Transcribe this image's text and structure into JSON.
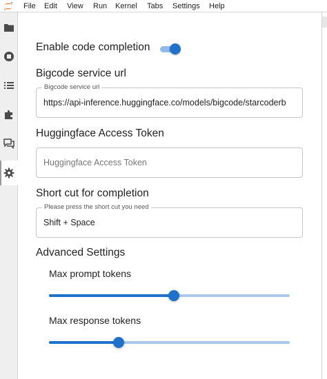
{
  "menubar": {
    "logo_icon": "jupyter-logo-icon",
    "items": [
      "File",
      "Edit",
      "View",
      "Run",
      "Kernel",
      "Tabs",
      "Settings",
      "Help"
    ]
  },
  "sidebar": {
    "icons": [
      "folder-icon",
      "stop-circle-icon",
      "list-icon",
      "puzzle-icon",
      "chat-icon",
      "gear-icon"
    ],
    "active": "gear-icon"
  },
  "settings": {
    "enable_completion": {
      "label": "Enable code completion",
      "enabled": true
    },
    "service_url": {
      "heading": "Bigcode service url",
      "legend": "Bigcode service url",
      "value": "https://api-inference.huggingface.co/models/bigcode/starcoderb"
    },
    "access_token": {
      "heading": "Huggingface Access Token",
      "placeholder": "Huggingface Access Token"
    },
    "shortcut": {
      "heading": "Short cut for completion",
      "legend": "Please press the short cut you need",
      "value": "Shift + Space"
    },
    "advanced": {
      "heading": "Advanced Settings",
      "max_prompt_tokens": {
        "label": "Max prompt tokens",
        "fraction": 0.52
      },
      "max_response_tokens": {
        "label": "Max response tokens",
        "fraction": 0.29
      }
    }
  },
  "colors": {
    "accent": "#1f72cc",
    "accent_light": "#a9c8ea"
  }
}
